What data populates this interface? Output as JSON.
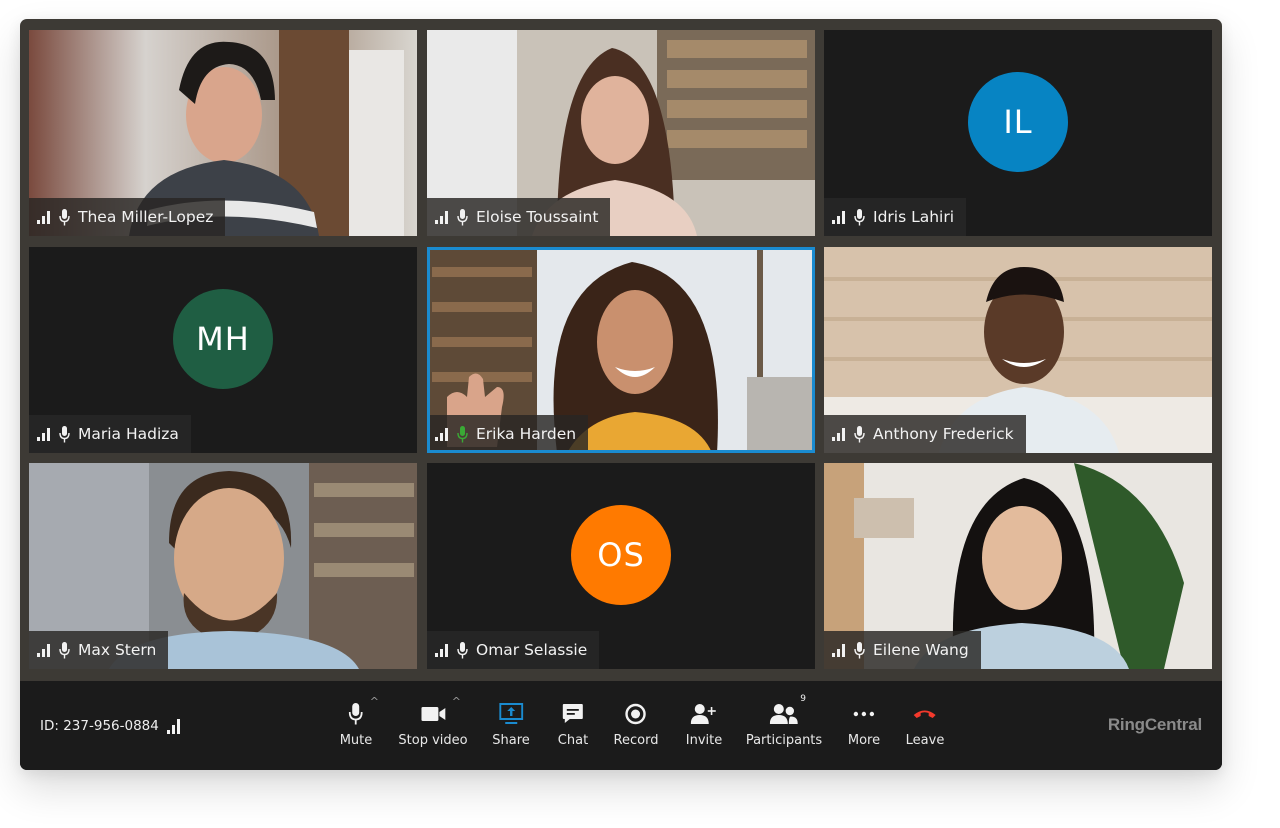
{
  "app": {
    "brand": "RingCentral",
    "accent_color": "#1a8bd0"
  },
  "meeting": {
    "id_label": "ID: 237-956-0884",
    "connection_icon": "signal-bars-icon"
  },
  "participants": [
    {
      "name": "Thea Miller-Lopez",
      "type": "video",
      "speaking": false
    },
    {
      "name": "Eloise Toussaint",
      "type": "video",
      "speaking": false
    },
    {
      "name": "Idris Lahiri",
      "type": "avatar",
      "initials": "IL",
      "color": "#0784c3",
      "speaking": false
    },
    {
      "name": "Maria Hadiza",
      "type": "avatar",
      "initials": "MH",
      "color": "#1f5e43",
      "speaking": false
    },
    {
      "name": "Erika Harden",
      "type": "video",
      "speaking": true,
      "active": true,
      "mic_color": "#3aa935"
    },
    {
      "name": "Anthony Frederick",
      "type": "video",
      "speaking": false
    },
    {
      "name": "Max Stern",
      "type": "video",
      "speaking": false
    },
    {
      "name": "Omar Selassie",
      "type": "avatar",
      "initials": "OS",
      "color": "#ff7a00",
      "speaking": false
    },
    {
      "name": "Eilene Wang",
      "type": "video",
      "speaking": false
    }
  ],
  "toolbar": {
    "mute": "Mute",
    "stop_video": "Stop video",
    "share": "Share",
    "chat": "Chat",
    "record": "Record",
    "invite": "Invite",
    "participants": "Participants",
    "participants_count": "9",
    "more": "More",
    "leave": "Leave",
    "share_color": "#1a8bd0",
    "leave_color": "#f4392c",
    "caret": "^"
  }
}
